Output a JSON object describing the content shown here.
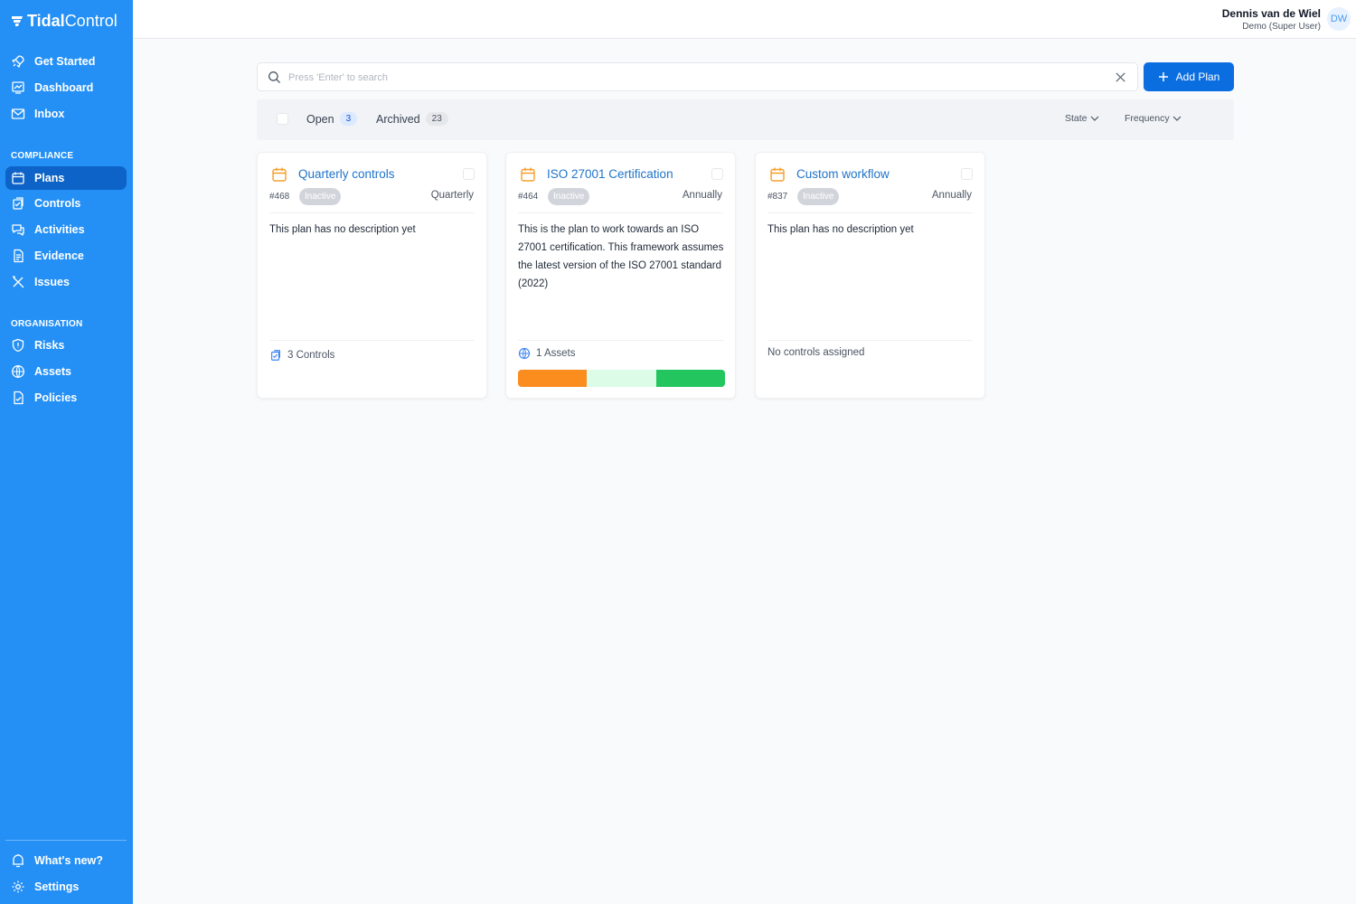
{
  "app": {
    "logo_bold": "Tidal",
    "logo_light": "Control"
  },
  "user": {
    "name": "Dennis van de Wiel",
    "role": "Demo (Super User)",
    "initials": "DW"
  },
  "nav": {
    "top": [
      {
        "label": "Get Started",
        "icon": "rocket-icon"
      },
      {
        "label": "Dashboard",
        "icon": "chart-icon"
      },
      {
        "label": "Inbox",
        "icon": "mail-icon"
      }
    ],
    "compliance_title": "COMPLIANCE",
    "compliance": [
      {
        "label": "Plans",
        "icon": "calendar-icon",
        "active": true
      },
      {
        "label": "Controls",
        "icon": "clipboard-icon"
      },
      {
        "label": "Activities",
        "icon": "chat-icon"
      },
      {
        "label": "Evidence",
        "icon": "document-icon"
      },
      {
        "label": "Issues",
        "icon": "tools-icon"
      }
    ],
    "organisation_title": "ORGANISATION",
    "organisation": [
      {
        "label": "Risks",
        "icon": "shield-icon"
      },
      {
        "label": "Assets",
        "icon": "globe-icon"
      },
      {
        "label": "Policies",
        "icon": "policy-icon"
      }
    ],
    "bottom": [
      {
        "label": "What's new?",
        "icon": "megaphone-icon"
      },
      {
        "label": "Settings",
        "icon": "gear-icon"
      }
    ]
  },
  "search": {
    "placeholder": "Press 'Enter' to search",
    "value": ""
  },
  "add_button": {
    "label": "Add Plan"
  },
  "tabs": [
    {
      "label": "Open",
      "count": "3"
    },
    {
      "label": "Archived",
      "count": "23"
    }
  ],
  "filters": {
    "state": "State",
    "frequency": "Frequency"
  },
  "colors": {
    "sidebar": "#2490f6",
    "active": "#0d63c7",
    "accent": "#0b6ee0",
    "calendar": "#f59e2a"
  },
  "plans": [
    {
      "title": "Quarterly controls",
      "number": "#468",
      "status": "Inactive",
      "frequency": "Quarterly",
      "description": "This plan has no description yet",
      "footer": "3 Controls",
      "footer_icon": "clipboard-icon"
    },
    {
      "title": "ISO 27001 Certification",
      "number": "#464",
      "status": "Inactive",
      "frequency": "Annually",
      "description": "This is the plan to work towards an ISO 27001 certification. This framework assumes the latest version of the ISO 27001 standard (2022)",
      "footer": "1 Assets",
      "footer_icon": "globe-icon",
      "progress": [
        {
          "fraction": 0.333,
          "color": "#fb8c1e"
        },
        {
          "fraction": 0.333,
          "color": "#dcfce7"
        },
        {
          "fraction": 0.334,
          "color": "#22c55e"
        }
      ]
    },
    {
      "title": "Custom workflow",
      "number": "#837",
      "status": "Inactive",
      "frequency": "Annually",
      "description": "This plan has no description yet",
      "footer": "No controls assigned"
    }
  ]
}
